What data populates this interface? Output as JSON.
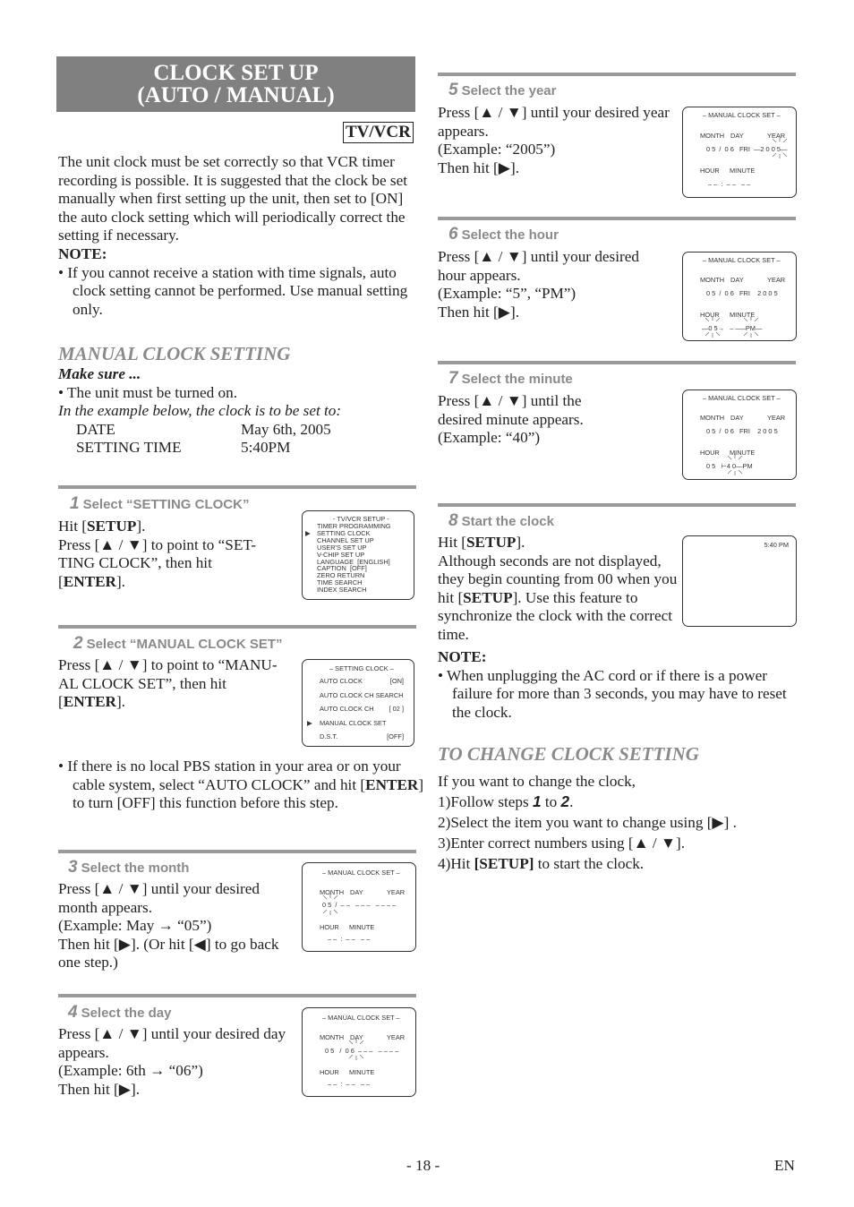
{
  "header": {
    "title_line1": "CLOCK SET UP",
    "title_line2": "(AUTO / MANUAL)",
    "badge": "TV/VCR"
  },
  "intro": {
    "text": "The unit clock must be set correctly so that VCR timer recording is possible. It is suggested that the clock be set manually when first setting up the unit, then set to [ON] the auto clock setting which will periodically correct the setting if necessary.",
    "note_label": "NOTE:",
    "note_bullet": "If you cannot receive a station with time signals, auto clock setting cannot be performed. Use manual setting only."
  },
  "manual": {
    "heading": "MANUAL CLOCK SETTING",
    "make_sure": "Make sure ...",
    "bullet": "The unit must be turned on.",
    "example_intro": "In the example below, the clock is to be set to:",
    "rows": [
      {
        "label": "DATE",
        "value": "May 6th, 2005"
      },
      {
        "label": "SETTING TIME",
        "value": "5:40PM"
      }
    ]
  },
  "steps": [
    {
      "num": "1",
      "title": "Select “SETTING CLOCK”",
      "lines": [
        "Hit [SETUP].",
        "Press [▲ / ▼] to point to “SET-TING CLOCK”, then hit [ENTER]."
      ]
    },
    {
      "num": "2",
      "title": "Select “MANUAL CLOCK SET”",
      "lines": [
        "Press [▲ / ▼] to point to “MANU-AL CLOCK SET”, then hit [ENTER]."
      ],
      "bullet": "If there is no local PBS station in your area or on your cable system, select “AUTO CLOCK” and hit [ENTER] to turn [OFF] this function before this step."
    },
    {
      "num": "3",
      "title": "Select the month",
      "lines": [
        "Press [▲ / ▼] until your desired month appears.",
        "(Example: May → “05”)",
        "Then hit [▶]. (Or hit [◀] to go back one step.)"
      ]
    },
    {
      "num": "4",
      "title": "Select the day",
      "lines": [
        "Press [▲ / ▼] until your desired day appears.",
        "(Example: 6th → “06”)",
        "Then hit [▶]."
      ]
    },
    {
      "num": "5",
      "title": "Select the year",
      "lines": [
        "Press [▲ / ▼] until your desired year appears.",
        "(Example: “2005”)",
        "Then hit [▶]."
      ]
    },
    {
      "num": "6",
      "title": "Select the hour",
      "lines": [
        "Press [▲ / ▼] until your desired hour appears.",
        "(Example: “5”, “PM”)",
        "Then hit [▶]."
      ]
    },
    {
      "num": "7",
      "title": "Select the minute",
      "lines": [
        "Press [▲ / ▼] until the desired minute appears.",
        "(Example: “40”)"
      ]
    },
    {
      "num": "8",
      "title": "Start the clock",
      "lines": [
        "Hit [SETUP].",
        "Although seconds are not displayed, they begin counting from 00 when you hit [SETUP]. Use this feature to synchronize the clock with the correct time."
      ],
      "note_label": "NOTE:",
      "note_bullet": "When unplugging the AC cord or if there is a power failure for more than 3 seconds, you may have to reset the clock."
    }
  ],
  "screens": {
    "setup_menu": {
      "title": "- TV/VCR SETUP -",
      "items": [
        "TIMER PROGRAMMING",
        "SETTING CLOCK",
        "CHANNEL SET UP",
        "USER'S SET UP",
        "V-CHIP SET UP",
        "LANGUAGE  [ENGLISH]",
        "CAPTION  [OFF]",
        "ZERO RETURN",
        "TIME SEARCH",
        "INDEX SEARCH"
      ],
      "selected": "SETTING CLOCK"
    },
    "setting_clock": {
      "title": "– SETTING CLOCK –",
      "items": [
        {
          "label": "AUTO CLOCK",
          "value": "[ON]"
        },
        {
          "label": "AUTO CLOCK CH SEARCH",
          "value": ""
        },
        {
          "label": "AUTO CLOCK CH",
          "value": "[ 02 ]"
        },
        {
          "label": "MANUAL CLOCK SET",
          "value": ""
        },
        {
          "label": "D.S.T.",
          "value": "[OFF]"
        }
      ],
      "selected": "MANUAL CLOCK SET"
    },
    "manual_clock": {
      "title": "– MANUAL CLOCK SET –",
      "labels": {
        "month": "MONTH",
        "day": "DAY",
        "year": "YEAR",
        "hour": "HOUR",
        "minute": "MINUTE"
      },
      "month_step": {
        "date": "0 5  /  – –   – – –   – – – –",
        "time": "– –  :  – –   – –",
        "blinking": "month"
      },
      "day_step": {
        "date": "0 5   /  0 6  – – –   – – – –",
        "time": "– –  :  – –   – –",
        "blinking": "day"
      },
      "year_step": {
        "date": "0 5  /  0 6   FRI  —2 0 0 5—",
        "time": "– –  :  – –   – –",
        "blinking": "year"
      },
      "hour_step": {
        "date": "0 5  /  0 6   FRI    2 0 0 5",
        "time": "—0 5→   – –—PM—",
        "blinking": "hour"
      },
      "minute_step": {
        "date": "0 5  /  0 6   FRI    2 0 0 5",
        "time": "0 5   ⊢4 0—PM",
        "blinking": "minute"
      }
    },
    "clock_display": {
      "time": "5:40 PM"
    }
  },
  "change": {
    "heading": "TO CHANGE CLOCK SETTING",
    "intro": "If you want to change the clock,",
    "items": [
      "1)Follow steps 1 to 2.",
      "2)Select the item you want to change using [▶] .",
      "3)Enter correct numbers using [▲ / ▼].",
      "4)Hit [SETUP] to start the clock."
    ]
  },
  "footer": {
    "page": "- 18 -",
    "lang": "EN"
  },
  "colors": {
    "title_bg": "#808080",
    "heading_gray": "#8a8a8a",
    "rule": "#9a9a9a"
  }
}
